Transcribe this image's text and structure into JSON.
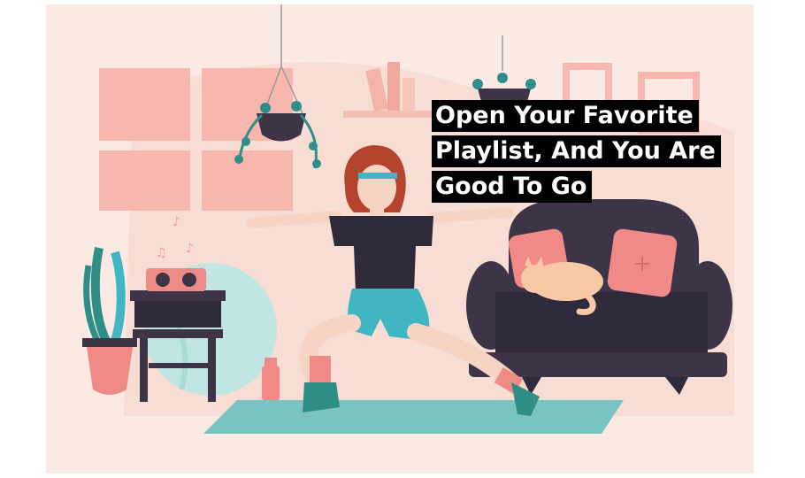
{
  "caption": {
    "line1": "Open Your Favorite",
    "line2": "Playlist, And You Are",
    "line3": "Good To Go"
  },
  "colors": {
    "background": "#fbe9e3",
    "window": "#f7b6ae",
    "sofa": "#3d3547",
    "shirt": "#2f2a3a",
    "shorts": "#3fb6c1",
    "mat": "#79c3c4",
    "pillow": "#f08a86",
    "cat": "#f7c9a6",
    "hair": "#b5442f"
  },
  "icons": [
    "music-note-icon",
    "plus-icon"
  ]
}
